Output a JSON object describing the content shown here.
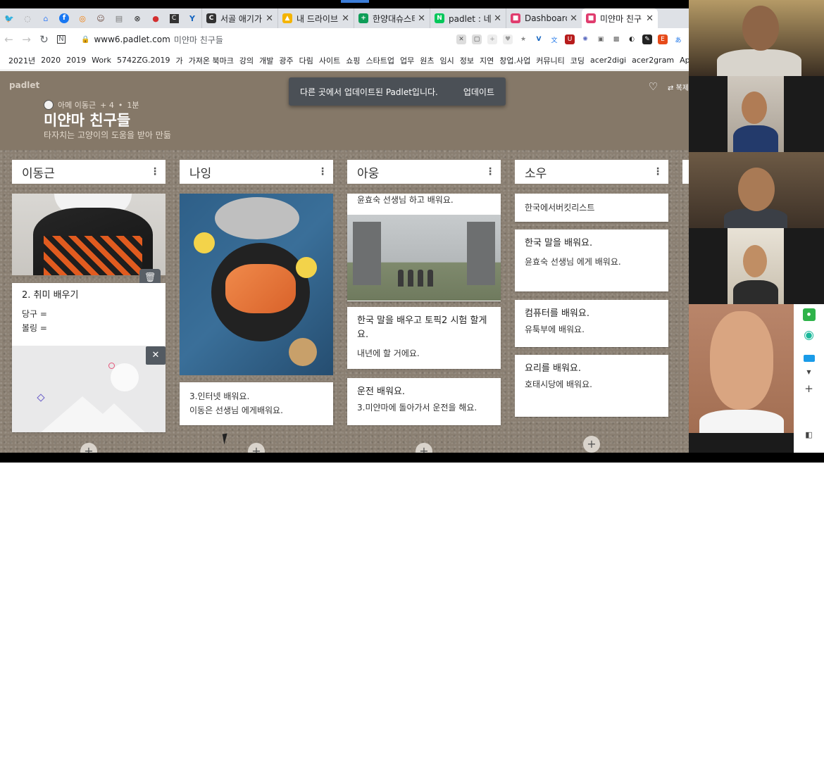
{
  "browser": {
    "tabs": [
      {
        "label": "서골 애기가",
        "fav_color": "#333333",
        "fav_text": "C"
      },
      {
        "label": "내 드라이브",
        "fav_color": "#f4b400",
        "fav_text": "▲"
      },
      {
        "label": "한양대슈스터",
        "fav_color": "#0f9d58",
        "fav_text": "+"
      },
      {
        "label": "padlet : 네이",
        "fav_color": "#03c75a",
        "fav_text": "N"
      },
      {
        "label": "Dashboard",
        "fav_color": "#e03c6e",
        "fav_text": "■"
      },
      {
        "label": "미얀마 친구",
        "fav_color": "#e03c6e",
        "fav_text": "■",
        "active": true
      }
    ],
    "url_host": "www6.padlet.com",
    "url_path": "미얀마 친구들",
    "bookmarks": [
      "2021년",
      "2020",
      "2019",
      "Work",
      "5742ZG.2019",
      "가",
      "가져온 북마크",
      "강의",
      "개발",
      "광주",
      "다림",
      "사이트",
      "쇼핑",
      "스타트업",
      "업무",
      "원츠",
      "임시",
      "정보",
      "지연",
      "창업.사업",
      "커뮤니티",
      "코딩",
      "acer2digi",
      "acer2gram",
      "Apps"
    ]
  },
  "padlet": {
    "logo": "padlet",
    "author": "아메 이동근",
    "contributors": "+ 4",
    "time": "1분",
    "title": "미얀마 친구들",
    "subtitle": "타자치는 고양이의 도움을 받아 만듦",
    "toast_message": "다른 곳에서 업데이트된 Padlet입니다.",
    "toast_action": "업데이트",
    "header_action": "복제",
    "columns": [
      {
        "name": "이동근",
        "cards": [
          {
            "title": "2. 취미 배우기",
            "lines": [
              "당구 =",
              "볼링 ="
            ]
          }
        ]
      },
      {
        "name": "나잉",
        "cards": [
          {
            "title": "",
            "lines": [
              "3.인터넷 배워요.",
              "이동은 선생님 에게배워요."
            ]
          }
        ]
      },
      {
        "name": "아웅",
        "cards": [
          {
            "title": "",
            "lines": [
              "윤효숙 선생님 하고 배워요."
            ]
          },
          {
            "title": "한국 말을 배우고 토픽2 시험 할게요.",
            "lines": [
              "내년에 할 거에요."
            ]
          },
          {
            "title": "운전 배워요.",
            "lines": [
              "3.미얀마에 돌아가서 운전을 해요."
            ]
          }
        ]
      },
      {
        "name": "소우",
        "cards": [
          {
            "title": "",
            "lines": [
              "한국에서버킷리스트"
            ]
          },
          {
            "title": "한국 말을 배워요.",
            "lines": [
              "윤효숙 선생님 에게 배워요."
            ]
          },
          {
            "title": "컴퓨터를 배워요.",
            "lines": [
              "유툭부에 배워요."
            ]
          },
          {
            "title": "요리를 배워요.",
            "lines": [
              "호태시당에 배워요."
            ]
          }
        ]
      }
    ],
    "add_symbol": "+"
  }
}
